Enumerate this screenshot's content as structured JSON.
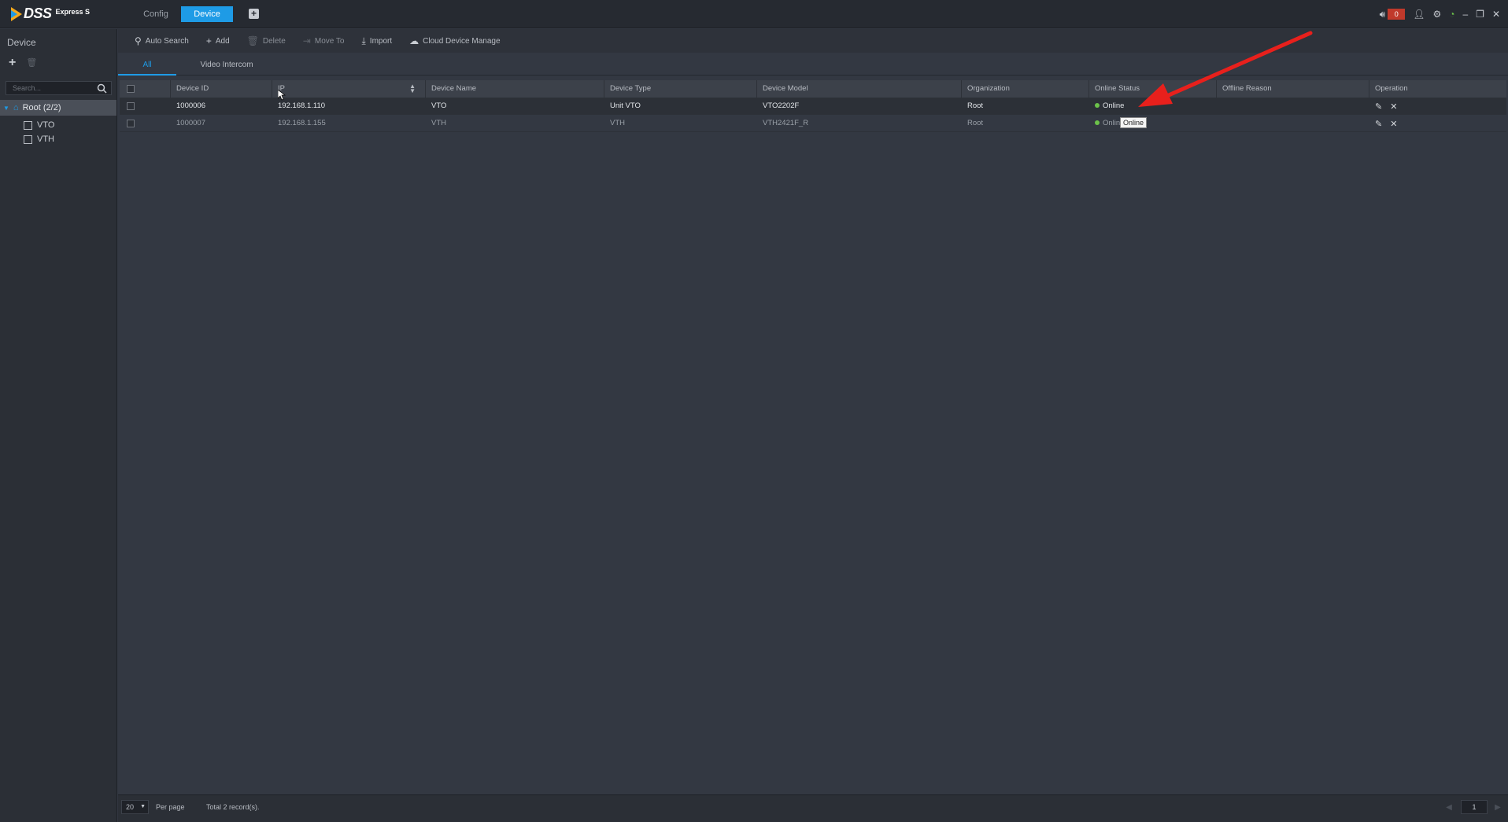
{
  "app": {
    "brand": "DSS",
    "edition": "Express S"
  },
  "top_tabs": {
    "config": "Config",
    "device": "Device",
    "add": "+"
  },
  "alarm": {
    "count": "0"
  },
  "left_panel": {
    "title": "Device",
    "search_placeholder": "Search...",
    "tree": {
      "root": "Root (2/2)",
      "children": [
        "VTO",
        "VTH"
      ]
    }
  },
  "toolbar": {
    "auto_search": "Auto Search",
    "add": "Add",
    "delete": "Delete",
    "move_to": "Move To",
    "import": "Import",
    "cloud_device_manage": "Cloud Device Manage"
  },
  "subtabs": {
    "all": "All",
    "video_intercom": "Video Intercom"
  },
  "table": {
    "columns": [
      "Device ID",
      "IP",
      "Device Name",
      "Device Type",
      "Device Model",
      "Organization",
      "Online Status",
      "Offline Reason",
      "Operation"
    ],
    "rows": [
      {
        "device_id": "1000006",
        "ip": "192.168.1.110",
        "name": "VTO",
        "type": "Unit VTO",
        "model": "VTO2202F",
        "org": "Root",
        "status": "Online",
        "offline_reason": ""
      },
      {
        "device_id": "1000007",
        "ip": "192.168.1.155",
        "name": "VTH",
        "type": "VTH",
        "model": "VTH2421F_R",
        "org": "Root",
        "status": "Online",
        "offline_reason": ""
      }
    ]
  },
  "tooltip": "Online",
  "footer": {
    "per_page_value": "20",
    "per_page_label": "Per page",
    "total": "Total 2 record(s).",
    "page": "1"
  },
  "colors": {
    "accent": "#1e9be6",
    "online": "#6cc24a",
    "annotation_arrow": "#e8201c"
  }
}
